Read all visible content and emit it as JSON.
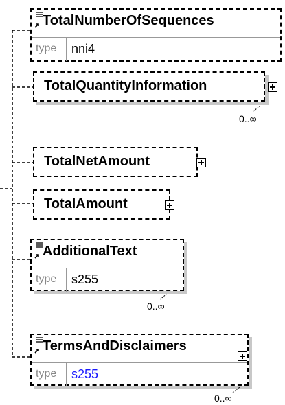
{
  "nodes": [
    {
      "name": "TotalNumberOfSequences",
      "type_label": "type",
      "type_value": "nni4"
    },
    {
      "name": "TotalQuantityInformation",
      "cardinality": "0..∞"
    },
    {
      "name": "TotalNetAmount"
    },
    {
      "name": "TotalAmount"
    },
    {
      "name": "AdditionalText",
      "type_label": "type",
      "type_value": "s255",
      "cardinality": "0..∞"
    },
    {
      "name": "TermsAndDisclaimers",
      "type_label": "type",
      "type_value": "s255",
      "cardinality": "0..∞"
    }
  ],
  "colors": {
    "link_type": "#1a1aff",
    "type_key": "#888888"
  }
}
